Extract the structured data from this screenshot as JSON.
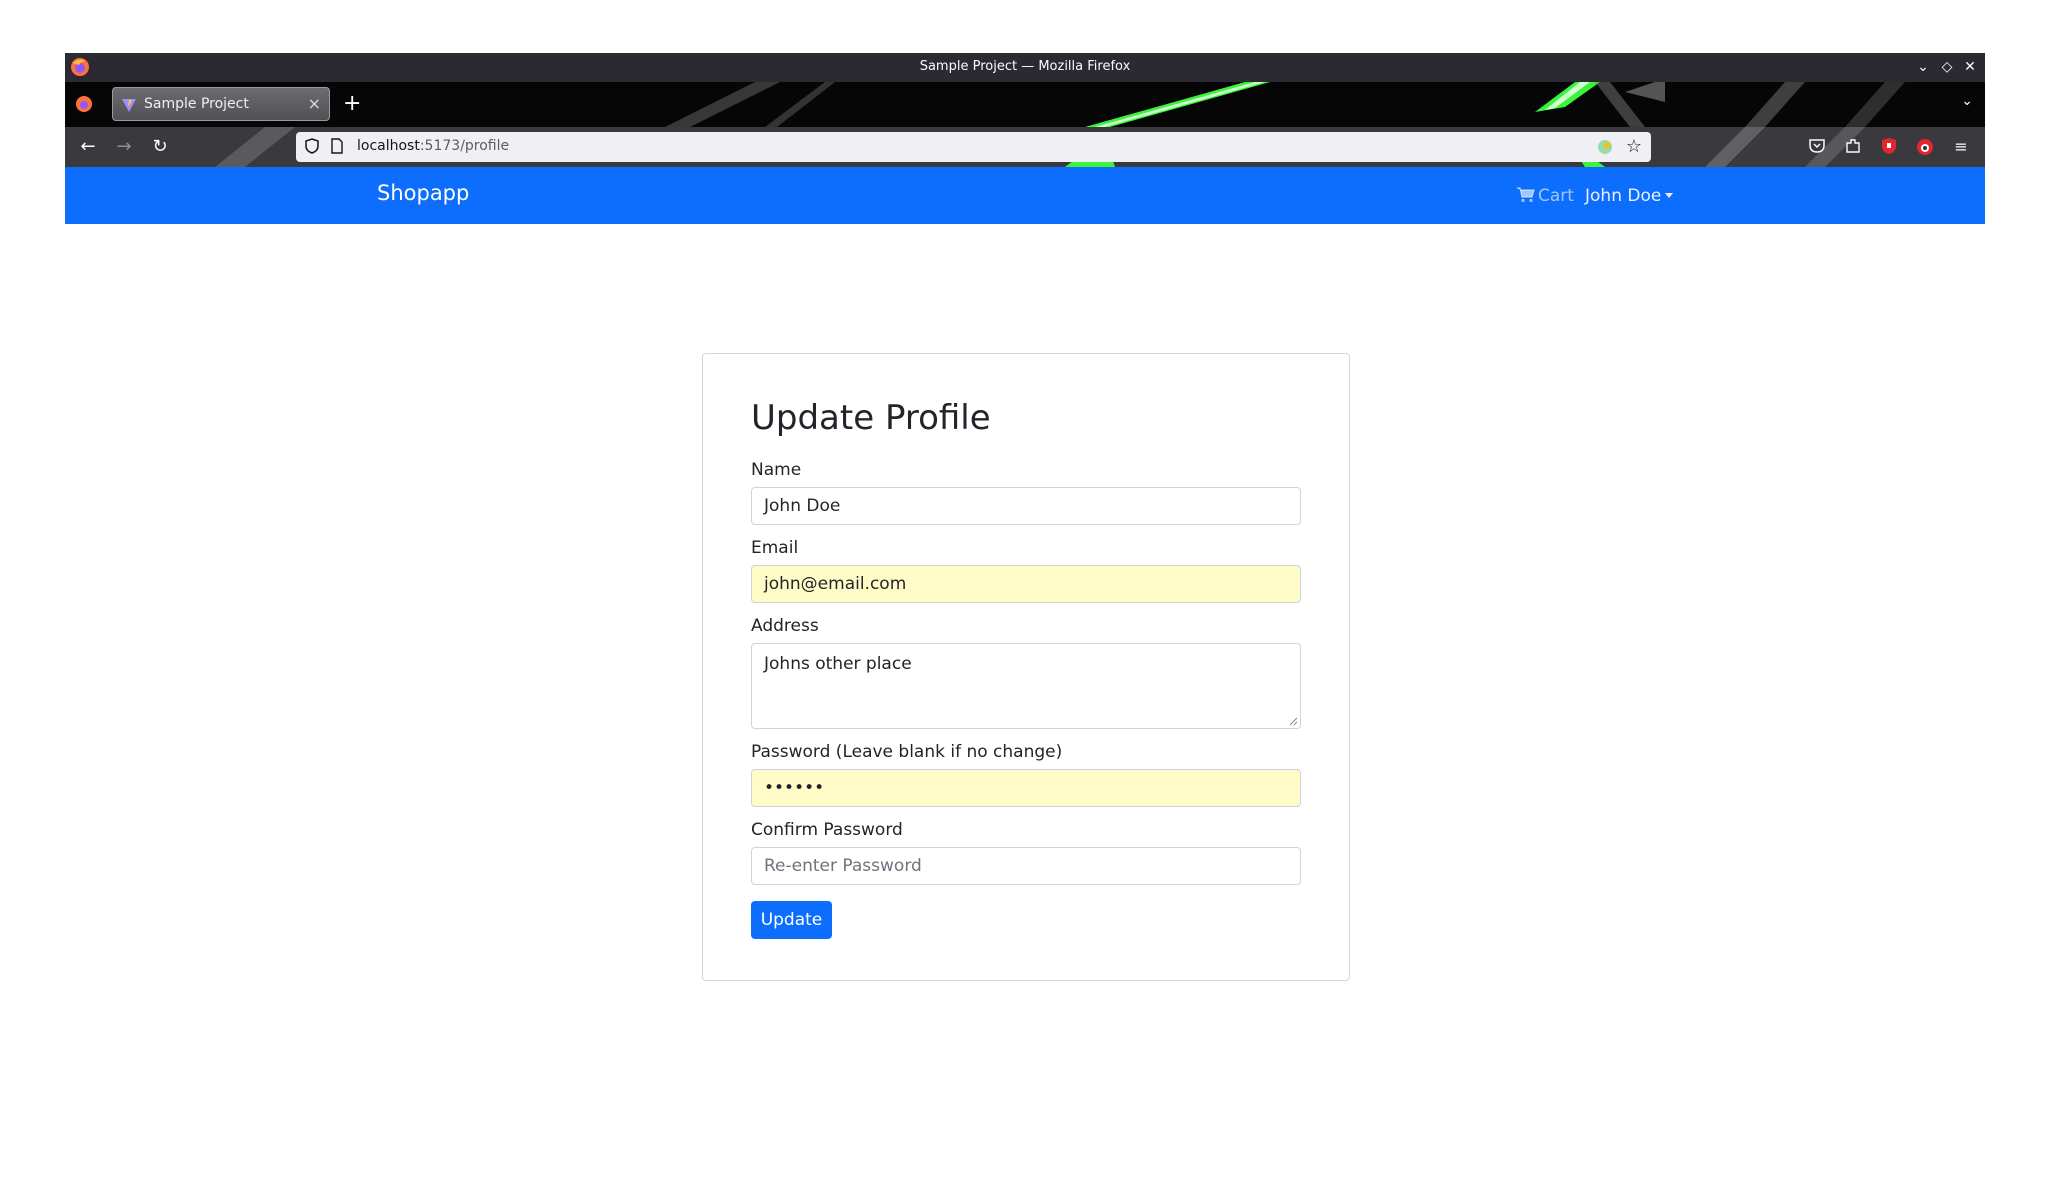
{
  "browser": {
    "window_title": "Sample Project — Mozilla Firefox",
    "tab_title": "Sample Project",
    "url_host": "localhost",
    "url_path": ":5173/profile"
  },
  "app": {
    "brand": "Shopapp",
    "cart_label": "Cart",
    "user_menu_label": "John Doe"
  },
  "form": {
    "title": "Update Profile",
    "name_label": "Name",
    "name_value": "John Doe",
    "email_label": "Email",
    "email_value": "john@email.com",
    "address_label": "Address",
    "address_value": "Johns other place",
    "password_label": "Password (Leave blank if no change)",
    "password_value": "••••••",
    "confirm_label": "Confirm Password",
    "confirm_placeholder": "Re-enter Password",
    "submit_label": "Update"
  },
  "colors": {
    "primary": "#0d6efd",
    "autofill": "#fffcc8",
    "browser_chrome": "#2b2a33"
  }
}
